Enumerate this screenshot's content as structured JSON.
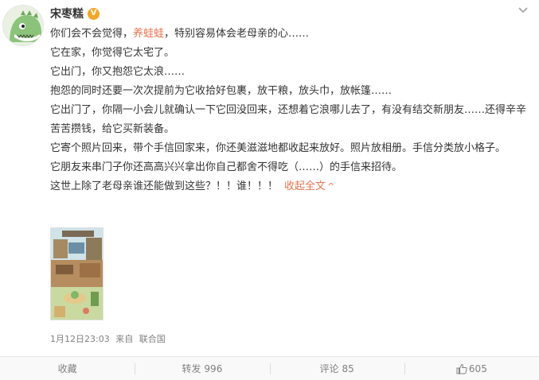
{
  "post": {
    "username": "宋枣糕",
    "vip_badge": "V",
    "lines": [
      {
        "pre": "你们会不会觉得，",
        "highlight": "养蛙蛙",
        "post": "，特别容易体会老母亲的心……"
      },
      {
        "text": "它在家，你觉得它太宅了。"
      },
      {
        "text": "它出门，你又抱怨它太浪……"
      },
      {
        "text": "抱怨的同时还要一次次提前为它收拾好包裹，放干粮，放头巾，放帐篷……"
      },
      {
        "text": "它出门了，你隔一小会儿就确认一下它回没回来，还想着它浪哪儿去了，有没有结交新朋友……还得辛辛苦苦攒钱，给它买新装备。"
      },
      {
        "text": "它寄个照片回来，带个手信回家来，你还美滋滋地都收起来放好。照片放相册。手信分类放小格子。"
      },
      {
        "text": "它朋友来串门子你还高高兴兴拿出你自己都舍不得吃（……）的手信来招待。"
      },
      {
        "pre": "这世上除了老母亲谁还能做到这些？！！谁！！！",
        "collapse": "收起全文"
      }
    ],
    "collapse_arrow": "^",
    "time": "1月12日23:03",
    "source_prefix": "来自",
    "source": "联合国"
  },
  "actions": {
    "favorite": "收藏",
    "repost_label": "转发",
    "repost_count": "996",
    "comment_label": "评论",
    "comment_count": "85",
    "like_count": "605"
  },
  "colors": {
    "accent": "#eb7350",
    "badge": "#f5a623",
    "text": "#333333",
    "muted": "#808080"
  }
}
